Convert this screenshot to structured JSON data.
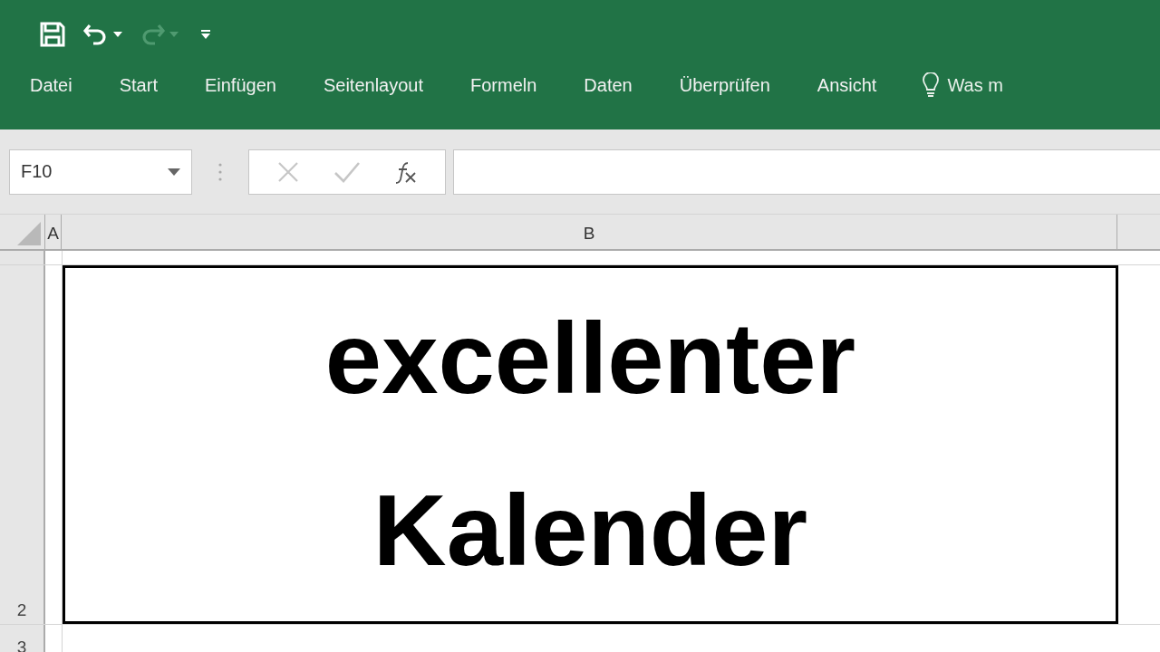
{
  "quick_access": [
    {
      "kind": "save",
      "disabled": false
    },
    {
      "kind": "undo",
      "disabled": false
    },
    {
      "kind": "redo",
      "disabled": true
    },
    {
      "kind": "customize",
      "disabled": false
    }
  ],
  "ribbon_tabs": [
    "Datei",
    "Start",
    "Einfügen",
    "Seitenlayout",
    "Formeln",
    "Daten",
    "Überprüfen",
    "Ansicht"
  ],
  "tell_me": {
    "text": "Was m"
  },
  "formula_bar": {
    "name_box": "F10",
    "cancel_disabled": true,
    "enter_disabled": true
  },
  "sheet": {
    "columns": [
      "A",
      "B"
    ],
    "rows": [
      {
        "label": "2",
        "cell_b": "excellenter Kalender"
      },
      {
        "label": "3"
      }
    ]
  }
}
